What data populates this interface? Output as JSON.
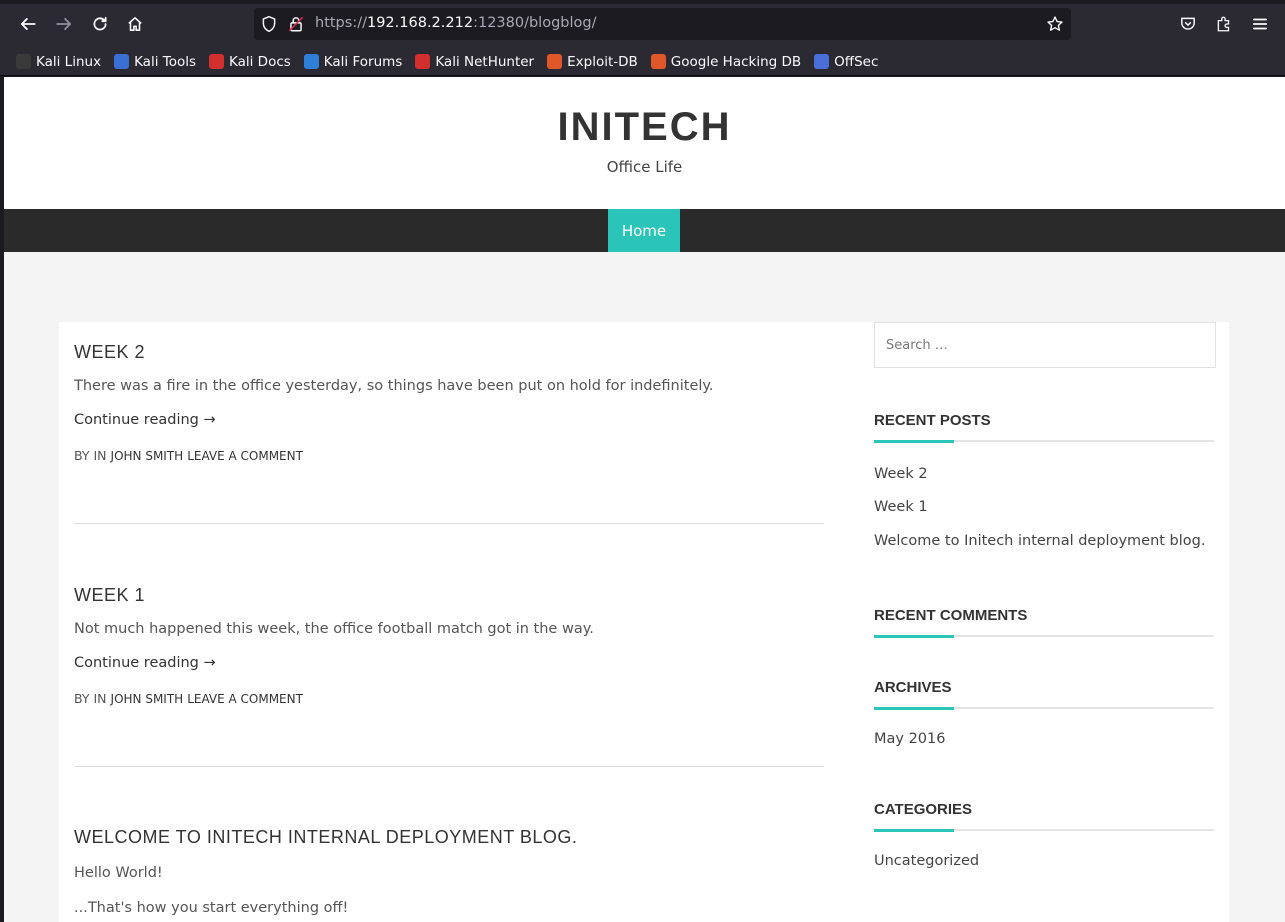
{
  "browser": {
    "url_prefix": "https://",
    "url_host": "192.168.2.212",
    "url_rest": ":12380/blogblog/",
    "bookmarks": [
      {
        "label": "Kali Linux",
        "color": "#3a3a3a"
      },
      {
        "label": "Kali Tools",
        "color": "#3b6fd4"
      },
      {
        "label": "Kali Docs",
        "color": "#d32f2f"
      },
      {
        "label": "Kali Forums",
        "color": "#2f7fd6"
      },
      {
        "label": "Kali NetHunter",
        "color": "#d32f2f"
      },
      {
        "label": "Exploit-DB",
        "color": "#e0572a"
      },
      {
        "label": "Google Hacking DB",
        "color": "#e0572a"
      },
      {
        "label": "OffSec",
        "color": "#4a6fd8"
      }
    ]
  },
  "site": {
    "title": "INITECH",
    "description": "Office Life",
    "nav_home": "Home",
    "accent_color": "#2bc4b9"
  },
  "posts": [
    {
      "title": "WEEK 2",
      "excerpt": "There was a fire in the office yesterday, so things have been put on hold for indefinitely.",
      "continue": "Continue reading →",
      "meta_prefix": "BY IN",
      "author": "JOHN SMITH",
      "comment": "LEAVE A COMMENT"
    },
    {
      "title": "WEEK 1",
      "excerpt": "Not much happened this week, the office football match got in the way.",
      "continue": "Continue reading →",
      "meta_prefix": "BY IN",
      "author": "JOHN SMITH",
      "comment": "LEAVE A COMMENT"
    },
    {
      "title": "WELCOME TO INITECH INTERNAL DEPLOYMENT BLOG.",
      "body_line1": "Hello World!",
      "body_line2": "...That's how you start everything off!"
    }
  ],
  "sidebar": {
    "search_placeholder": "Search …",
    "recent_posts": {
      "title": "RECENT POSTS",
      "items": [
        "Week 2",
        "Week 1",
        "Welcome to Initech internal deployment blog."
      ]
    },
    "recent_comments": {
      "title": "RECENT COMMENTS"
    },
    "archives": {
      "title": "ARCHIVES",
      "items": [
        "May 2016"
      ]
    },
    "categories": {
      "title": "CATEGORIES",
      "items": [
        "Uncategorized"
      ]
    }
  }
}
